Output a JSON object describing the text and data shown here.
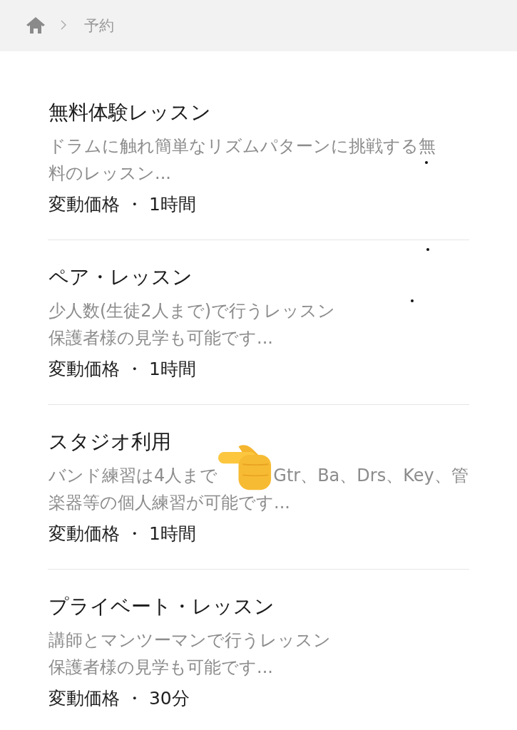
{
  "breadcrumb": {
    "current": "予約"
  },
  "lessons": [
    {
      "title": "無料体験レッスン",
      "description": [
        [
          "ドラムに触れ簡単なリズムパターンに挑戦する無"
        ],
        [
          "料のレッスン..."
        ]
      ],
      "meta": "変動価格 ・ 1時間"
    },
    {
      "title": "ペア・レッスン",
      "description": [
        [
          "少人数(生徒2人まで)で行うレッスン"
        ],
        [
          "保護者様の見学も可能です..."
        ]
      ],
      "meta": "変動価格 ・ 1時間"
    },
    {
      "title": "スタジオ利用",
      "description": [
        [
          "バンド練習は4人まで",
          "Gtr、Ba、Drs、Key、管"
        ],
        [
          "楽器等の個人練習が可能です..."
        ]
      ],
      "meta": "変動価格 ・ 1時間"
    },
    {
      "title": "プライベート・レッスン",
      "description": [
        [
          "講師とマンツーマンで行うレッスン"
        ],
        [
          "保護者様の見学も可能です..."
        ]
      ],
      "meta": "変動価格 ・ 30分"
    }
  ]
}
